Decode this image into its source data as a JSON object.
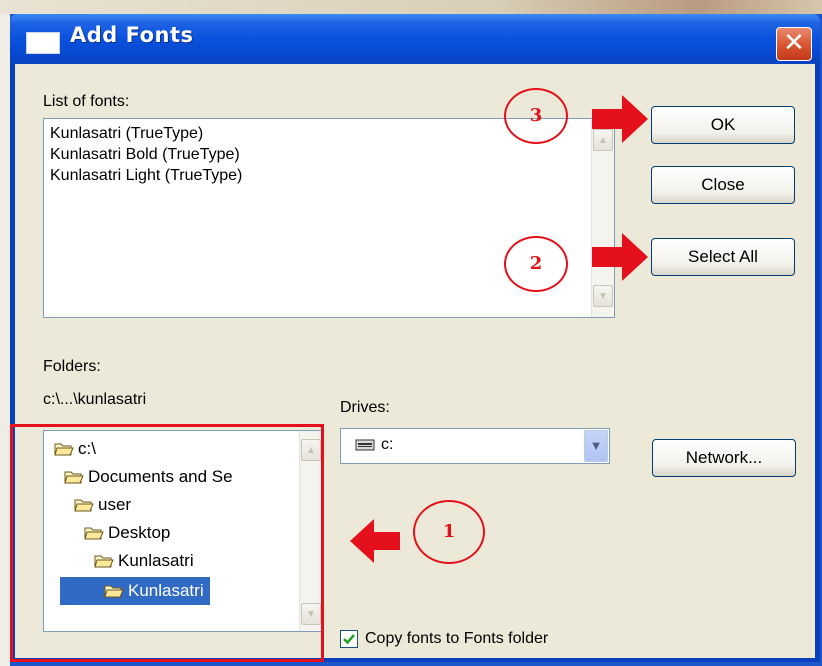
{
  "window": {
    "title": "Add Fonts",
    "close_glyph": "✕"
  },
  "fonts_list": {
    "label": "List of fonts:",
    "items": [
      "Kunlasatri (TrueType)",
      "Kunlasatri Bold (TrueType)",
      "Kunlasatri Light (TrueType)"
    ]
  },
  "buttons": {
    "ok": "OK",
    "close": "Close",
    "select_all": "Select All",
    "network": "Network..."
  },
  "folders": {
    "label": "Folders:",
    "current_path": "c:\\...\\kunlasatri",
    "tree": [
      {
        "name": "c:\\",
        "selected": false
      },
      {
        "name": "Documents and Se",
        "selected": false
      },
      {
        "name": "user",
        "selected": false
      },
      {
        "name": "Desktop",
        "selected": false
      },
      {
        "name": "Kunlasatri",
        "selected": false
      },
      {
        "name": "Kunlasatri",
        "selected": true
      }
    ]
  },
  "drives": {
    "label": "Drives:",
    "value": "c:"
  },
  "copy_fonts": {
    "label": "Copy fonts to Fonts folder",
    "checked": true
  },
  "annotations": {
    "step1": "1",
    "step2": "2",
    "step3": "3",
    "color": "#e4101b"
  },
  "icons": [
    "folder-icon",
    "drive-icon",
    "chevron-down-icon",
    "close-icon",
    "arrow-right-icon",
    "arrow-left-icon"
  ]
}
